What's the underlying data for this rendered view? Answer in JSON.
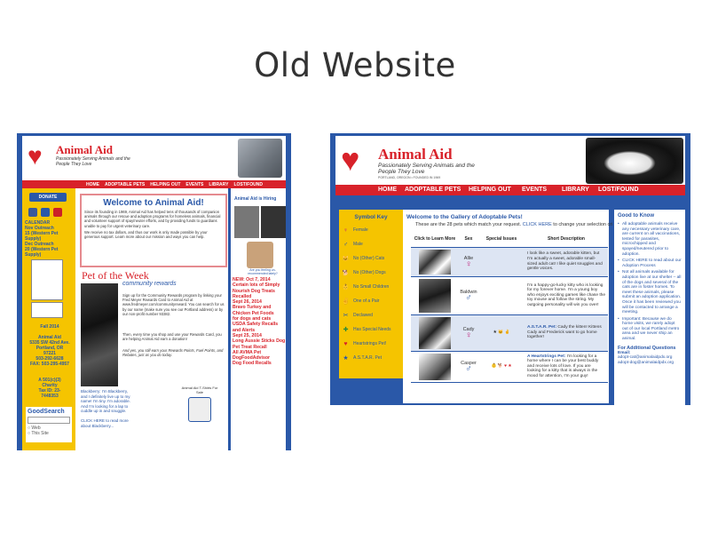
{
  "slide": {
    "title": "Old Website"
  },
  "left_site": {
    "logo": {
      "name": "Animal Aid",
      "tagline": "Passionately Serving Animals and the People They Love",
      "tiny": "PORTLAND, OREGON • FOUNDED IN 1969"
    },
    "nav": [
      "HOME",
      "ADOPTABLE PETS",
      "HELPING OUT",
      "EVENTS",
      "LIBRARY",
      "LOST/FOUND"
    ],
    "sidebar": {
      "donate": "DONATE",
      "calendar": "CALENDAR\nNov Outreach\n15 (Western Pet\nSupply)\nDec Outreach\n20 (Western Pet\nSupply)",
      "fall": "Fall 2014",
      "address": "Animal Aid\n5335 SW 42nd Ave.\nPortland, OR\n97221\n503-292-6628\nFAX: 503-295-4957",
      "charity": "A 501(c)(3)\nCharity\nTax ID: 23-\n7448353",
      "search": {
        "logo": "GoodSearch",
        "options": [
          "Web",
          "This Site"
        ]
      }
    },
    "welcome": {
      "heading": "Welcome to Animal Aid!",
      "p1": "Since its founding in 1969, Animal Aid has helped tens of thousands of companion animals through our rescue and adoption programs for homeless animals, financial and volunteer support of spay/neuter efforts, and by providing funds to guardians unable to pay for urgent veterinary care.",
      "p2": "We receive no tax dollars, and thus our work is only made possible by your generous support. Learn more about our mission and ways you can help."
    },
    "pet_of_week": "Pet of the Week",
    "community": {
      "logo": "community rewards",
      "p1": "Sign up for the Community Rewards program by linking your Fred Meyer Rewards Card to Animal Aid at www.fredmeyer.com/communityreward. You can search for us by our name (make sure you see our Portland address) or by our non-profit number 93382.",
      "p2": "Then, every time you shop and use your Rewards Card, you are helping Animal Aid earn a donation!",
      "p3": "And yes, you still earn your Rewards Points, Fuel Points, and Rebates, just as you do today."
    },
    "tshirts": "Animal Aid T-Shirts For Sale",
    "blackberry": "Blackberry: I'm Blackberry, and I definitely live up to my name! I'm tiny. I'm adorable. And I'm looking for a lap to cuddle up in and snuggle.\n\nCLICK HERE to read more about Blackberry...",
    "right_col": {
      "hiring": "Animal Aid is Hiring",
      "ad": "Are you feeling un-recommended lately?",
      "news": "NEW: Oct 7, 2014\nCertain lots of Simply Nourish Dog Treats Recalled\nSept 26, 2014\nBravo Turkey and Chicken Pet Foods\nfor dogs and cats\nUSDA Safety Recalls and Alerts\nSept 25, 2014\nLong Aussie Sticks Dog\nPet Treat Recall\nAll AVMA Pet\nDogFoodAdvisor\nDog Food Recalls"
    }
  },
  "right_site": {
    "logo": {
      "name": "Animal Aid",
      "tagline": "Passionately Serving Animals and the People They Love",
      "tiny": "PORTLAND, OREGON • FOUNDED IN 1969"
    },
    "nav": [
      "HOME",
      "ADOPTABLE PETS",
      "HELPING OUT",
      "EVENTS",
      "LIBRARY",
      "LOST/FOUND"
    ],
    "symbol_key": {
      "title": "Symbol Key",
      "items": [
        {
          "icon": "♀",
          "label": "Female"
        },
        {
          "icon": "♂",
          "label": "Male"
        },
        {
          "icon": "🐱",
          "label": "No (Other) Cats"
        },
        {
          "icon": "🐕",
          "label": "No (Other) Dogs"
        },
        {
          "icon": "👶",
          "label": "No Small Children"
        },
        {
          "icon": "✌",
          "label": "One of a Pair"
        },
        {
          "icon": "✂",
          "label": "Declawed"
        },
        {
          "icon": "✚",
          "label": "Has Special Needs"
        },
        {
          "icon": "♥",
          "label": "Heartstrings Pet!"
        },
        {
          "icon": "★",
          "label": "A.S.T.A.R. Pet"
        }
      ]
    },
    "gallery": {
      "heading": "Welcome to the Gallery of Adoptable Pets!",
      "intro_prefix": "These are the 28 pets which match your request. ",
      "intro_link": "CLICK HERE",
      "intro_suffix": " to change your selection criteria.",
      "columns": [
        "Click to Learn More",
        "Sex",
        "Special Issues",
        "Short Description"
      ],
      "rows": [
        {
          "name": "Allie",
          "sex": "♀",
          "issues": "",
          "highlight": "",
          "desc": "I look like a sweet, adorable kitten, but I'm actually a sweet, adorable small-sized adult cat! I like quiet snuggles and gentle voices."
        },
        {
          "name": "Baldwin",
          "sex": "♂",
          "issues": "",
          "highlight": "",
          "desc": "I'm a happy-go-lucky kitty who is looking for my forever home. I'm a young boy who enjoys exciting games like chase the toy mouse and follow the string. My outgoing personality will win you over!"
        },
        {
          "name": "Cady",
          "sex": "♀",
          "issues": "★ 🐱 ✌",
          "highlight": "A.S.T.A.R. Pet:",
          "desc": " Cady the kitten! Kittens Cady and Frederick want to go home together!"
        },
        {
          "name": "Casper",
          "sex": "♂",
          "issues": "👶 🐕 ♥ ★",
          "highlight": "A Heartstrings Pet:",
          "desc": " I'm looking for a home where I can be your best buddy and receive lots of love. If you are looking for a kitty that is always in the mood for attention, I'm your guy!"
        }
      ]
    },
    "good_to_know": {
      "title": "Good to Know",
      "items": [
        "All adoptable animals receive any necessary veterinary care, are current on all vaccinations, tested for parasites, microchipped and spayed/neutered prior to adoption.",
        "CLICK HERE to read about our Adoption Process",
        "Not all animals available for adoption live at our shelter – all of the dogs and several of the cats are in foster homes. To meet these animals, please submit an adoption application. Once it has been reviewed you will be contacted to arrange a meeting.",
        "Important: Because we do home visits, we rarely adopt out of our local Portland metro area and we never ship an animal."
      ],
      "questions_title": "For Additional Questions",
      "email_label": "Email:",
      "emails": [
        "adopt-cat@animalaidpdx.org",
        "adopt-dog@animalaidpdx.org"
      ]
    }
  },
  "colors": {
    "blue": "#2a58a8",
    "red": "#d8222a",
    "yellow": "#f5c400"
  }
}
